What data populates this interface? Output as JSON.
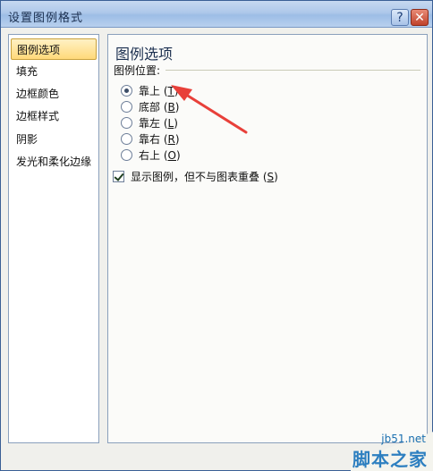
{
  "window": {
    "title": "设置图例格式",
    "help_label": "?",
    "close_label": "✕"
  },
  "sidebar": {
    "items": [
      {
        "label": "图例选项",
        "active": true
      },
      {
        "label": "填充"
      },
      {
        "label": "边框颜色"
      },
      {
        "label": "边框样式"
      },
      {
        "label": "阴影"
      },
      {
        "label": "发光和柔化边缘"
      }
    ]
  },
  "panel": {
    "title": "图例选项",
    "section": "图例位置:",
    "positions": [
      {
        "label": "靠上",
        "key": "T",
        "checked": true
      },
      {
        "label": "底部",
        "key": "B"
      },
      {
        "label": "靠左",
        "key": "L"
      },
      {
        "label": "靠右",
        "key": "R"
      },
      {
        "label": "右上",
        "key": "O"
      }
    ],
    "overlap": {
      "label": "显示图例，但不与图表重叠",
      "key": "S",
      "checked": true
    }
  },
  "annotation": {
    "arrow_color": "#e8403a"
  },
  "watermark": {
    "site": "jb51.net",
    "name": "脚本之家"
  }
}
